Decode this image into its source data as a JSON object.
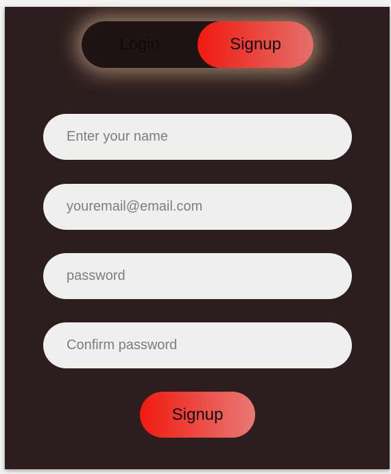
{
  "toggle": {
    "login_label": "Login",
    "signup_label": "Signup",
    "active": "Signup"
  },
  "form": {
    "name_placeholder": "Enter your name",
    "email_placeholder": "youremail@email.com",
    "password_placeholder": "password",
    "confirm_placeholder": "Confirm password",
    "submit_label": "Signup"
  },
  "colors": {
    "card_background": "#2c1e1e",
    "accent_start": "#f01a10",
    "accent_end": "#e4706a",
    "field_background": "#efefef",
    "glow": "#ecc8a0"
  }
}
